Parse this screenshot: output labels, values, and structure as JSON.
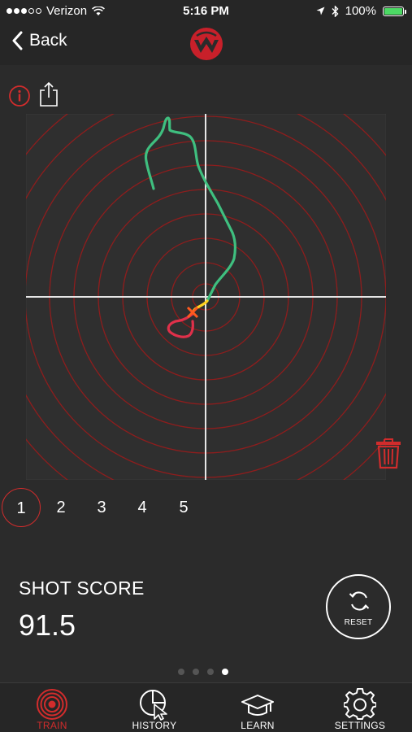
{
  "status_bar": {
    "carrier": "Verizon",
    "time": "5:16 PM",
    "battery": "100%",
    "signal_bars_on": 3,
    "signal_bars_total": 5
  },
  "nav": {
    "back_label": "Back",
    "logo_icon": "mantis-logo-icon"
  },
  "toolbar": {
    "info_icon": "info-icon",
    "share_icon": "share-icon",
    "trash_icon": "trash-icon"
  },
  "shots": {
    "items": [
      "1",
      "2",
      "3",
      "4",
      "5"
    ],
    "selected": "1"
  },
  "score": {
    "label": "SHOT SCORE",
    "value": "91.5"
  },
  "reset": {
    "label": "RESET"
  },
  "pager": {
    "count": 4,
    "active_index": 3
  },
  "tabs": [
    {
      "label": "TRAIN",
      "icon": "target-icon",
      "active": true
    },
    {
      "label": "HISTORY",
      "icon": "history-icon",
      "active": false
    },
    {
      "label": "LEARN",
      "icon": "graduation-cap-icon",
      "active": false
    },
    {
      "label": "SETTINGS",
      "icon": "gear-icon",
      "active": false
    }
  ],
  "colors": {
    "accent_red": "#d22c2c",
    "ring_red": "#8e1d1d",
    "trace_green": "#3fbf7f",
    "trace_yellow": "#ffd21f",
    "trace_red": "#e0304a",
    "background": "#2b2b2b",
    "battery_green": "#4cd964"
  }
}
